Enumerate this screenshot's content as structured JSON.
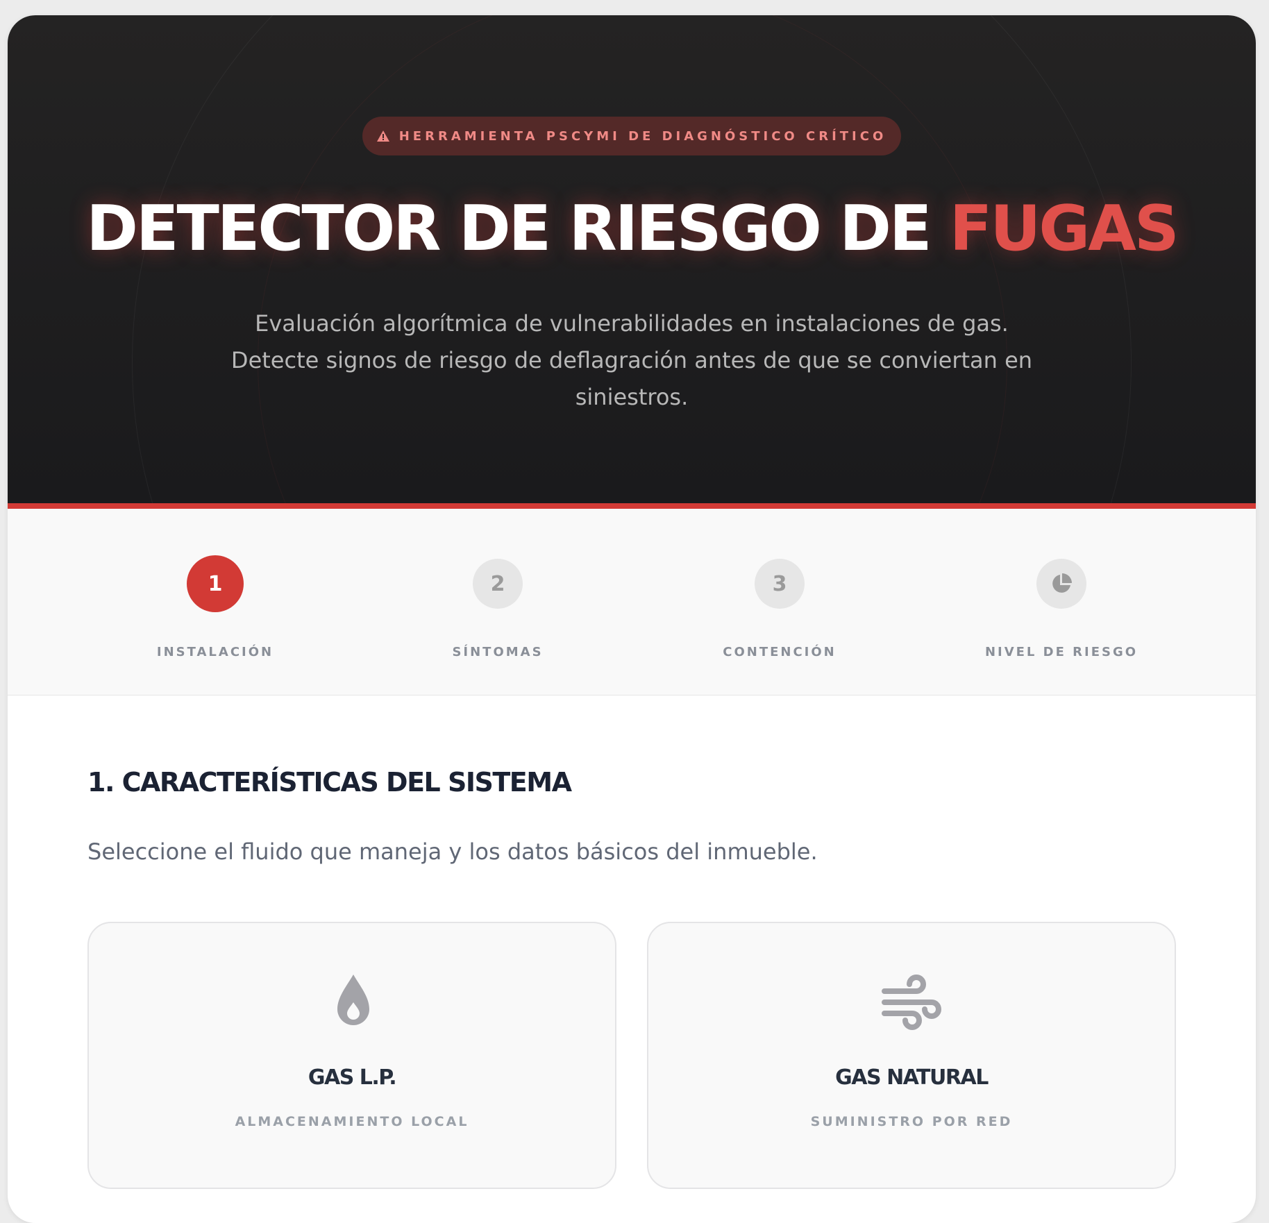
{
  "hero": {
    "badge": "HERRAMIENTA PSCYMI DE DIAGNÓSTICO CRÍTICO",
    "badge_icon": "warning-icon",
    "title_main": "DETECTOR DE RIESGO DE ",
    "title_accent": "FUGAS",
    "subtitle_line1": "Evaluación algorítmica de vulnerabilidades en instalaciones de gas.",
    "subtitle_line2": "Detecte signos de riesgo de deflagración antes de que se conviertan en",
    "subtitle_line3": "siniestros."
  },
  "stepper": {
    "steps": [
      {
        "number": "1",
        "label": "INSTALACIÓN",
        "state": "active"
      },
      {
        "number": "2",
        "label": "SÍNTOMAS",
        "state": "pending"
      },
      {
        "number": "3",
        "label": "CONTENCIÓN",
        "state": "pending"
      },
      {
        "number": "",
        "label": "NIVEL DE RIESGO",
        "state": "pending",
        "icon": "pie-chart-icon"
      }
    ]
  },
  "section": {
    "title": "1. CARACTERÍSTICAS DEL SISTEMA",
    "description": "Seleccione el fluido que maneja y los datos básicos del inmueble."
  },
  "options": [
    {
      "name": "GAS L.P.",
      "description": "ALMACENAMIENTO LOCAL",
      "icon": "droplet-icon"
    },
    {
      "name": "GAS NATURAL",
      "description": "SUMINISTRO POR RED",
      "icon": "wind-icon"
    }
  ],
  "colors": {
    "accent": "#d23a35",
    "hero_bg": "#1f1f20",
    "heading": "#1b2233"
  }
}
